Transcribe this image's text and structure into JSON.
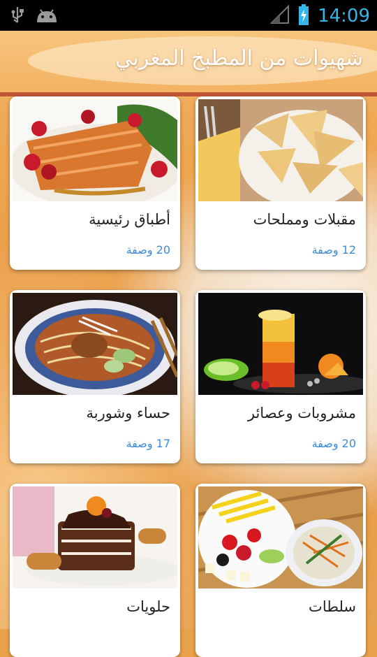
{
  "status_bar": {
    "time": "14:09",
    "left_icons": [
      "usb-icon",
      "android-icon"
    ],
    "right_icons": [
      "signal-icon",
      "battery-charging-icon"
    ]
  },
  "header": {
    "title": "شهيوات من المطبخ المغربي"
  },
  "categories": [
    {
      "name": "مقبلات ومملحات",
      "count": "12 وصفة"
    },
    {
      "name": "أطباق رئيسية",
      "count": "20 وصفة"
    },
    {
      "name": "مشروبات وعصائر",
      "count": "20 وصفة"
    },
    {
      "name": "حساء وشوربة",
      "count": "17 وصفة"
    },
    {
      "name": "سلطات",
      "count": ""
    },
    {
      "name": "حلويات",
      "count": ""
    }
  ]
}
